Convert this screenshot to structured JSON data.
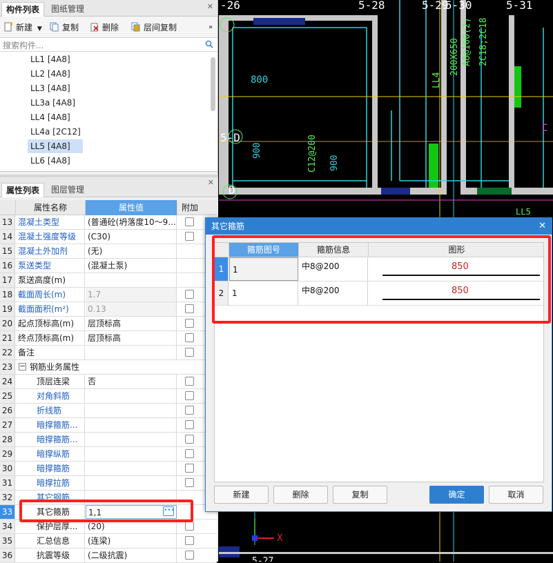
{
  "component_panel": {
    "tabs": [
      "构件列表",
      "图纸管理"
    ],
    "toolbar": {
      "new": "新建",
      "copy": "复制",
      "delete": "删除",
      "floor_copy": "层间复制"
    },
    "search_placeholder": "搜索构件...",
    "items": [
      "LL1 [4A8]",
      "LL2 [4A8]",
      "LL3 [4A8]",
      "LL3a [4A8]",
      "LL4 [4A8]",
      "LL4a [2C12]",
      "LL5 [4A8]",
      "LL6 [4A8]"
    ],
    "selected_item": "LL5 [4A8]"
  },
  "attr_panel": {
    "tabs": [
      "属性列表",
      "图层管理"
    ],
    "headers": {
      "name": "属性名称",
      "value": "属性值",
      "extra": "附加"
    },
    "rows": [
      {
        "num": "13",
        "name": "混凝土类型",
        "value": "(普通砼(坍落度10～9...",
        "blue": true,
        "chk": true
      },
      {
        "num": "14",
        "name": "混凝土强度等级",
        "value": "(C30)",
        "blue": true,
        "chk": true
      },
      {
        "num": "15",
        "name": "混凝土外加剂",
        "value": "(无)",
        "blue": true,
        "chk": false
      },
      {
        "num": "16",
        "name": "泵送类型",
        "value": "(混凝土泵)",
        "blue": true,
        "chk": false
      },
      {
        "num": "17",
        "name": "泵送高度(m)",
        "value": "",
        "blue": false,
        "chk": false
      },
      {
        "num": "18",
        "name": "截面周长(m)",
        "value": "1.7",
        "blue": true,
        "chk": true,
        "gray": true
      },
      {
        "num": "19",
        "name": "截面面积(m²)",
        "value": "0.13",
        "blue": true,
        "chk": true,
        "gray": true
      },
      {
        "num": "20",
        "name": "起点顶标高(m)",
        "value": "层顶标高",
        "blue": false,
        "chk": true
      },
      {
        "num": "21",
        "name": "终点顶标高(m)",
        "value": "层顶标高",
        "blue": false,
        "chk": true
      },
      {
        "num": "22",
        "name": "备注",
        "value": "",
        "blue": false,
        "chk": true
      },
      {
        "num": "23",
        "name": "钢筋业务属性",
        "value": "",
        "group": true
      },
      {
        "num": "24",
        "name": "顶层连梁",
        "value": "否",
        "indent": true,
        "chk": true
      },
      {
        "num": "25",
        "name": "对角斜筋",
        "value": "",
        "indent": true,
        "blue": true,
        "chk": true
      },
      {
        "num": "26",
        "name": "折线筋",
        "value": "",
        "indent": true,
        "blue": true,
        "chk": true
      },
      {
        "num": "27",
        "name": "暗撑箍筋...",
        "value": "",
        "indent": true,
        "blue": true,
        "chk": true
      },
      {
        "num": "28",
        "name": "暗撑箍筋...",
        "value": "",
        "indent": true,
        "blue": true,
        "chk": true
      },
      {
        "num": "29",
        "name": "暗撑纵筋",
        "value": "",
        "indent": true,
        "blue": true,
        "chk": true
      },
      {
        "num": "30",
        "name": "暗撑箍筋",
        "value": "",
        "indent": true,
        "blue": true,
        "chk": true
      },
      {
        "num": "31",
        "name": "暗撑拉筋",
        "value": "",
        "indent": true,
        "blue": true,
        "chk": true
      },
      {
        "num": "32",
        "name": "其它钢筋",
        "value": "",
        "indent": true,
        "blue": true,
        "chk": false
      },
      {
        "num": "33",
        "name": "其它箍筋",
        "value": "1,1",
        "indent": true,
        "blue": false,
        "chk": false,
        "active": true
      },
      {
        "num": "34",
        "name": "保护层厚...",
        "value": "(20)",
        "indent": true,
        "blue": false,
        "chk": true
      },
      {
        "num": "35",
        "name": "汇总信息",
        "value": "(连梁)",
        "indent": true,
        "blue": false,
        "chk": true
      },
      {
        "num": "36",
        "name": "抗震等级",
        "value": "(二级抗震)",
        "indent": true,
        "blue": false,
        "chk": true
      }
    ]
  },
  "cad": {
    "labels": {
      "axis_526": "-26",
      "axis_528": "5-28",
      "axis_529": "5-29",
      "axis_530": "5-30",
      "axis_531": "5-31",
      "dim_800": "800",
      "dim_900a": "900",
      "dim_900b": "900",
      "beam_size": "200X650",
      "beam_stirrup": "A8@100(2)",
      "beam_long": "2C18;2C18",
      "ll4": "LL4",
      "axis_5d": "5-D",
      "bar_c12": "C12@200",
      "axis_d": "D",
      "ll5": "LL5",
      "axis_c": "C",
      "x_axis": "X",
      "axis_527": "5-27"
    }
  },
  "dialog": {
    "title": "其它箍筋",
    "columns": [
      "箍筋图号",
      "箍筋信息",
      "图形"
    ],
    "rows": [
      {
        "num": "1",
        "fig_no": "1",
        "info": "中8@200",
        "shape_value": "850"
      },
      {
        "num": "2",
        "fig_no": "1",
        "info": "中8@200",
        "shape_value": "850"
      }
    ],
    "buttons": {
      "new": "新建",
      "delete": "删除",
      "copy": "复制",
      "ok": "确定",
      "cancel": "取消"
    }
  }
}
